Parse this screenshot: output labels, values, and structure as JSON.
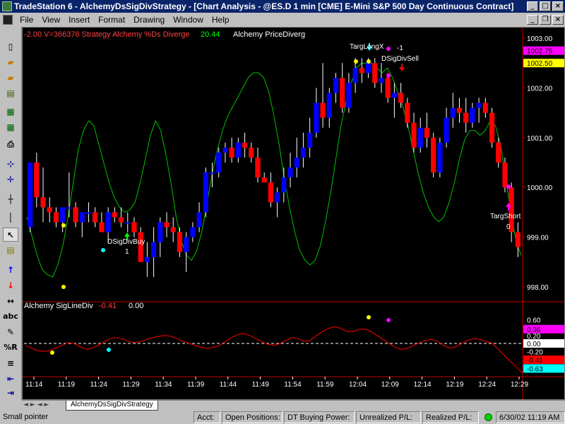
{
  "window": {
    "title": "TradeStation 6 - AlchemyDsSigDivStrategy - [Chart Analysis - @ES.D  1 min  [CME] E-Mini S&P 500 Day Continuous Contract]"
  },
  "menu": [
    "File",
    "View",
    "Insert",
    "Format",
    "Drawing",
    "Window",
    "Help"
  ],
  "toolbar": {
    "icons": [
      "new-icon",
      "open-icon",
      "open-folder-icon",
      "workspace-icon",
      "chart-icon",
      "quote-icon",
      "print-icon",
      "cursor-cross-icon",
      "crosshair-icon",
      "hline-icon",
      "vline-icon",
      "pointer-icon",
      "text-note-icon",
      "buy-arrow-icon",
      "sell-arrow-icon",
      "horizontal-arrows-icon",
      "abc-icon",
      "pencil-icon",
      "percent-r-icon",
      "lines-icon",
      "first-bar-icon",
      "last-bar-icon"
    ],
    "labels": {
      "abc": "abc",
      "pct_r": "%R"
    }
  },
  "header": {
    "prefix": "-2.00  V=366376  Strategy  Alchemy  %Ds Diverge",
    "value": "20.44",
    "suffix": "Alchemy  PriceDiverg"
  },
  "lower_header": {
    "label": "Alchemy  SigLineDiv",
    "value1": "-0.41",
    "value2": "0.00"
  },
  "colors": {
    "up_bar": "#0000ff",
    "down_bar": "#ff0000",
    "stoch_line": "#00c000",
    "sigline": "#ff0000",
    "bg": "#000000",
    "yellow_marker": "#ffff00",
    "magenta_marker": "#ff00ff",
    "cyan_marker": "#00ffff"
  },
  "chart_data": [
    {
      "type": "candlestick",
      "title": "@ES.D 1 min",
      "y_axis": {
        "range": [
          997.9,
          1003.1
        ],
        "ticks": [
          "1003.00",
          "1002.00",
          "1001.00",
          "1000.00",
          "999.00",
          "998.00"
        ],
        "tick_values": [
          1003,
          1002,
          1001,
          1000,
          999,
          998
        ],
        "price_tags": [
          {
            "label": "1002.75",
            "value": 1002.75,
            "color": "#ff00ff"
          },
          {
            "label": "1002.50",
            "value": 1002.5,
            "color": "#ffff00"
          }
        ]
      },
      "x_axis": {
        "ticks": [
          "11:14",
          "11:19",
          "11:24",
          "11:29",
          "11:34",
          "11:39",
          "11:44",
          "11:49",
          "11:54",
          "11:59",
          "12:04",
          "12:09",
          "12:14",
          "12:19",
          "12:24",
          "12:29"
        ]
      },
      "bars": [
        [
          999.2,
          1000.5,
          999.1,
          1000.5
        ],
        [
          1000.5,
          1000.7,
          999.6,
          999.8
        ],
        [
          999.8,
          1000.4,
          999.3,
          999.6
        ],
        [
          999.6,
          999.8,
          999.3,
          999.5
        ],
        [
          999.5,
          999.6,
          999.2,
          999.3
        ],
        [
          999.3,
          999.6,
          999.1,
          999.6
        ],
        [
          999.6,
          1000.3,
          999.4,
          999.6
        ],
        [
          999.6,
          999.7,
          999.2,
          999.3
        ],
        [
          999.3,
          999.5,
          999.0,
          999.5
        ],
        [
          999.5,
          999.7,
          999.3,
          999.5
        ],
        [
          999.5,
          999.6,
          999.2,
          999.3
        ],
        [
          999.3,
          999.5,
          999.1,
          999.1
        ],
        [
          999.1,
          999.6,
          998.9,
          999.5
        ],
        [
          999.5,
          999.6,
          999.3,
          999.4
        ],
        [
          999.4,
          999.6,
          999.2,
          999.3
        ],
        [
          999.3,
          999.5,
          999.1,
          999.3
        ],
        [
          999.3,
          999.4,
          999.0,
          999.1
        ],
        [
          999.1,
          999.2,
          998.5,
          998.5
        ],
        [
          998.5,
          998.9,
          998.2,
          998.6
        ],
        [
          998.6,
          999.2,
          998.2,
          998.9
        ],
        [
          998.9,
          999.4,
          998.6,
          999.3
        ],
        [
          999.3,
          999.5,
          999.0,
          999.2
        ],
        [
          999.2,
          999.4,
          998.9,
          999.1
        ],
        [
          999.1,
          999.2,
          998.6,
          998.7
        ],
        [
          998.7,
          999.1,
          998.3,
          999.0
        ],
        [
          999.0,
          999.3,
          998.9,
          999.2
        ],
        [
          999.2,
          999.7,
          999.1,
          999.5
        ],
        [
          999.5,
          1000.4,
          999.4,
          1000.3
        ],
        [
          1000.3,
          1000.5,
          1000.0,
          1000.3
        ],
        [
          1000.3,
          1000.8,
          1000.2,
          1000.7
        ],
        [
          1000.7,
          1000.9,
          1000.5,
          1000.8
        ],
        [
          1000.8,
          1001.0,
          1000.5,
          1000.6
        ],
        [
          1000.6,
          1001.0,
          1000.5,
          1000.9
        ],
        [
          1000.9,
          1001.1,
          1000.6,
          1000.8
        ],
        [
          1000.8,
          1000.9,
          1000.5,
          1000.6
        ],
        [
          1000.6,
          1000.8,
          1000.1,
          1000.2
        ],
        [
          1000.2,
          1000.3,
          1000.1,
          1000.1
        ],
        [
          1000.1,
          1000.3,
          999.6,
          999.7
        ],
        [
          999.7,
          1000.0,
          999.4,
          999.9
        ],
        [
          999.9,
          1000.4,
          999.7,
          1000.2
        ],
        [
          1000.2,
          1000.7,
          1000.0,
          1000.4
        ],
        [
          1000.4,
          1001.0,
          1000.2,
          1000.6
        ],
        [
          1000.6,
          1001.1,
          1000.4,
          1000.8
        ],
        [
          1000.8,
          1001.4,
          1000.6,
          1001.1
        ],
        [
          1001.1,
          1002.0,
          1001.0,
          1001.7
        ],
        [
          1001.7,
          1002.5,
          1001.2,
          1001.4
        ],
        [
          1001.4,
          1002.0,
          1001.2,
          1001.9
        ],
        [
          1001.9,
          1002.3,
          1001.7,
          1002.2
        ],
        [
          1002.2,
          1002.5,
          1001.5,
          1001.6
        ],
        [
          1001.6,
          1002.3,
          1001.5,
          1002.1
        ],
        [
          1002.1,
          1002.6,
          1001.9,
          1002.4
        ],
        [
          1002.4,
          1002.6,
          1002.1,
          1002.3
        ],
        [
          1002.3,
          1002.6,
          1002.2,
          1002.5
        ],
        [
          1002.5,
          1002.6,
          1002.0,
          1002.1
        ],
        [
          1002.1,
          1002.5,
          1001.9,
          1002.2
        ],
        [
          1002.2,
          1002.3,
          1001.7,
          1001.8
        ],
        [
          1001.8,
          1002.1,
          1001.4,
          1001.9
        ],
        [
          1001.9,
          1002.1,
          1001.6,
          1001.7
        ],
        [
          1001.7,
          1001.8,
          1001.2,
          1001.3
        ],
        [
          1001.3,
          1001.5,
          1000.7,
          1000.8
        ],
        [
          1000.8,
          1001.4,
          1000.7,
          1001.2
        ],
        [
          1001.2,
          1001.5,
          1000.8,
          1001.0
        ],
        [
          1001.0,
          1001.1,
          1000.2,
          1000.3
        ],
        [
          1000.3,
          1001.0,
          1000.2,
          1000.9
        ],
        [
          1000.9,
          1001.6,
          1000.8,
          1001.4
        ],
        [
          1001.4,
          1001.9,
          1001.2,
          1001.6
        ],
        [
          1001.6,
          1001.8,
          1001.3,
          1001.5
        ],
        [
          1001.5,
          1001.8,
          1001.1,
          1001.3
        ],
        [
          1001.3,
          1001.7,
          1001.2,
          1001.6
        ],
        [
          1001.6,
          1001.8,
          1001.3,
          1001.7
        ],
        [
          1001.7,
          1001.8,
          1001.4,
          1001.5
        ],
        [
          1001.5,
          1001.6,
          1000.8,
          1000.9
        ],
        [
          1000.9,
          1001.0,
          1000.4,
          1000.5
        ],
        [
          1000.5,
          1000.6,
          999.9,
          1000.0
        ],
        [
          1000.0,
          1000.1,
          998.9,
          999.1
        ],
        [
          999.1,
          999.3,
          998.6,
          998.8
        ]
      ]
    },
    {
      "type": "line",
      "name": "Alchemy %Ds Diverge",
      "values": [
        30,
        22,
        14,
        8,
        6,
        5,
        10,
        18,
        30,
        44,
        58,
        66,
        70,
        68,
        60,
        52,
        44,
        38,
        34,
        32,
        33,
        36,
        44,
        54,
        64,
        70,
        66,
        56,
        44,
        30,
        20,
        14,
        12,
        16,
        24,
        36,
        48,
        58,
        66,
        72,
        76,
        80,
        84,
        88,
        90,
        90,
        88,
        82,
        72,
        60,
        46,
        34,
        24,
        16,
        12,
        10,
        12,
        18,
        28,
        40,
        54,
        68,
        78,
        86,
        92,
        94,
        94,
        94,
        92,
        90,
        92,
        88,
        82,
        76,
        68,
        58,
        48,
        40,
        34,
        30,
        28,
        30,
        36,
        44,
        54,
        62,
        66,
        66,
        64,
        66,
        70,
        68,
        60,
        46,
        32,
        20,
        14
      ],
      "y_range": [
        0,
        100
      ]
    },
    {
      "type": "line",
      "name": "Alchemy SigLineDiv",
      "y_axis": {
        "ticks": [
          "0.60",
          "0.20",
          "0.00",
          "-0.20",
          "-0.63"
        ],
        "tick_values": [
          0.6,
          0.2,
          0.0,
          -0.2,
          -0.63
        ],
        "value_tags": [
          {
            "label": "0.36",
            "value": 0.36,
            "color": "#ff00ff"
          },
          {
            "label": "0.00",
            "value": 0.0,
            "color": "#ffffff"
          },
          {
            "label": "-0.41",
            "value": -0.41,
            "color": "#ff0000"
          },
          {
            "label": "-0.63",
            "value": -0.63,
            "color": "#00ffff"
          }
        ],
        "range": [
          -0.8,
          0.8
        ]
      },
      "values": [
        -0.05,
        -0.12,
        -0.18,
        -0.2,
        -0.18,
        -0.12,
        -0.05,
        0.02,
        0.0,
        -0.08,
        -0.15,
        -0.12,
        -0.05,
        0.05,
        0.12,
        0.15,
        0.12,
        0.05,
        0.02,
        0.05,
        0.1,
        0.15,
        0.18,
        0.2,
        0.18,
        0.12,
        0.05,
        0.0,
        -0.05,
        -0.1,
        -0.12,
        -0.1,
        -0.05,
        0.05,
        0.15,
        0.22,
        0.25,
        0.2,
        0.12,
        0.05,
        -0.02,
        -0.05,
        0.0,
        0.08,
        0.15,
        0.12,
        0.05,
        0.08,
        0.2,
        0.3,
        0.38,
        0.42,
        0.38,
        0.3,
        0.3,
        0.35,
        0.36,
        0.3,
        0.2,
        0.1,
        0.0,
        -0.1,
        -0.15,
        -0.12,
        -0.05,
        0.02,
        0.08,
        0.1,
        0.05,
        -0.05,
        -0.12,
        -0.08,
        0.0,
        0.08,
        0.12,
        0.1,
        0.05,
        0.0,
        -0.15,
        -0.3,
        -0.45,
        -0.6,
        -0.75
      ]
    }
  ],
  "annotations": {
    "sig_buy": {
      "label": "DSigDivBuy",
      "count": "1"
    },
    "targ_long": {
      "label": "TargLongX",
      "count": "-1"
    },
    "sig_sell": {
      "label": "DSigDivSell"
    },
    "targ_short": {
      "label": "TargShort",
      "count": "0"
    }
  },
  "tabs": {
    "active": "AlchemyDsSigDivStrategy"
  },
  "status": {
    "pointer": "Small pointer",
    "acct": "Acct:",
    "positions": "Open Positions:",
    "buying_power": "DT Buying Power:",
    "unrealized": "Unrealized P/L:",
    "realized": "Realized P/L:",
    "datetime": "6/30/02 11:19 AM"
  }
}
